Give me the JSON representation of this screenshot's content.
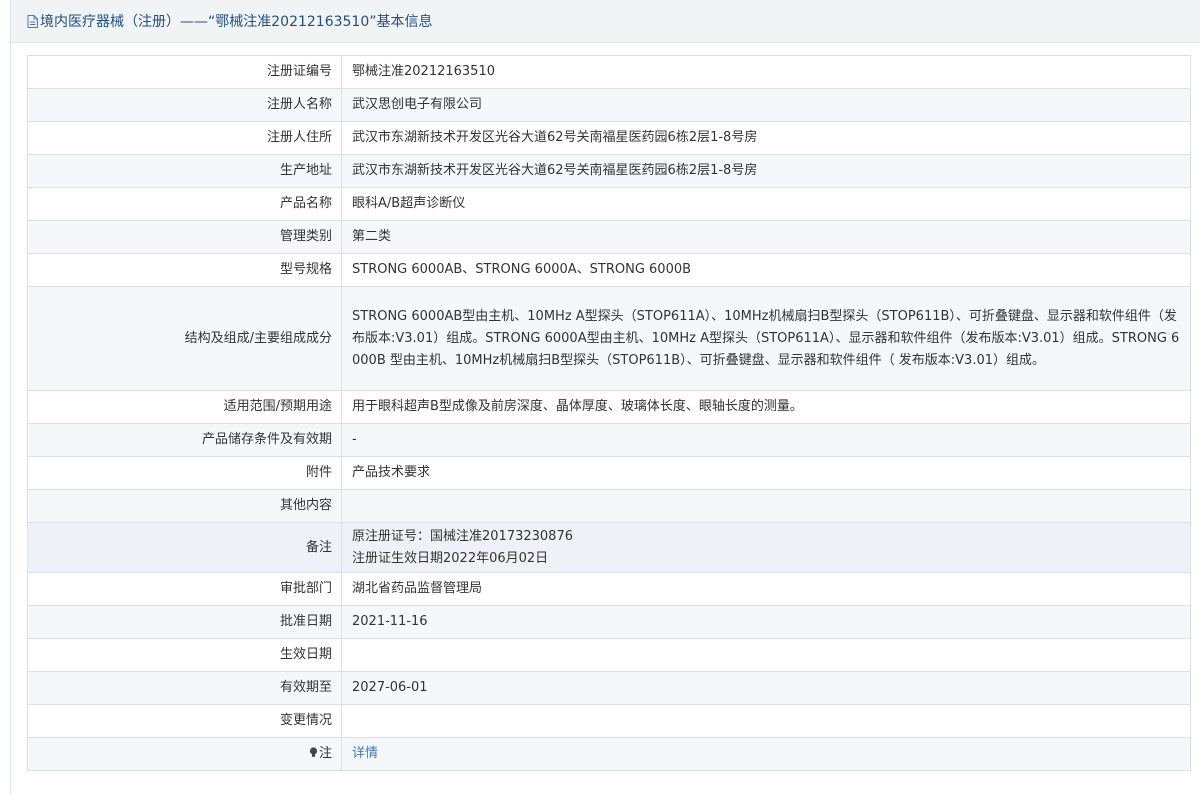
{
  "header": {
    "title": "境内医疗器械（注册）——“鄂械注准20212163510”基本信息",
    "icon": "document-icon"
  },
  "rows": [
    {
      "label": "注册证编号",
      "value": "鄂械注准20212163510"
    },
    {
      "label": "注册人名称",
      "value": "武汉思创电子有限公司"
    },
    {
      "label": "注册人住所",
      "value": "武汉市东湖新技术开发区光谷大道62号关南福星医药园6栋2层1-8号房"
    },
    {
      "label": "生产地址",
      "value": "武汉市东湖新技术开发区光谷大道62号关南福星医药园6栋2层1-8号房"
    },
    {
      "label": "产品名称",
      "value": "眼科A/B超声诊断仪"
    },
    {
      "label": "管理类别",
      "value": "第二类"
    },
    {
      "label": "型号规格",
      "value": "STRONG 6000AB、STRONG 6000A、STRONG 6000B"
    },
    {
      "label": "结构及组成/主要组成成分",
      "value": "STRONG 6000AB型由主机、10MHz A型探头（STOP611A）、10MHz机械扇扫B型探头（STOP611B）、可折叠键盘、显示器和软件组件（发布版本:V3.01）组成。STRONG 6000A型由主机、10MHz A型探头（STOP611A）、显示器和软件组件（发布版本:V3.01）组成。STRONG 6000B 型由主机、10MHz机械扇扫B型探头（STOP611B）、可折叠键盘、显示器和软件组件（ 发布版本:V3.01）组成。"
    },
    {
      "label": "适用范围/预期用途",
      "value": "用于眼科超声B型成像及前房深度、晶体厚度、玻璃体长度、眼轴长度的测量。"
    },
    {
      "label": "产品储存条件及有效期",
      "value": "-"
    },
    {
      "label": "附件",
      "value": "产品技术要求"
    },
    {
      "label": "其他内容",
      "value": ""
    },
    {
      "label": "备注",
      "value_line1": "原注册证号：国械注准20173230876",
      "value_line2": "注册证生效日期2022年06月02日"
    },
    {
      "label": "审批部门",
      "value": "湖北省药品监督管理局"
    },
    {
      "label": "批准日期",
      "value": "2021-11-16"
    },
    {
      "label": "生效日期",
      "value": ""
    },
    {
      "label": "有效期至",
      "value": "2027-06-01"
    },
    {
      "label": "变更情况",
      "value": ""
    },
    {
      "label": "注",
      "icon": "lightbulb-icon",
      "link": "详情"
    }
  ],
  "colors": {
    "title": "#1f4f8a",
    "link": "#3a7bc8",
    "border": "#dcdfe4",
    "row_alt": "#f5f7fa"
  }
}
